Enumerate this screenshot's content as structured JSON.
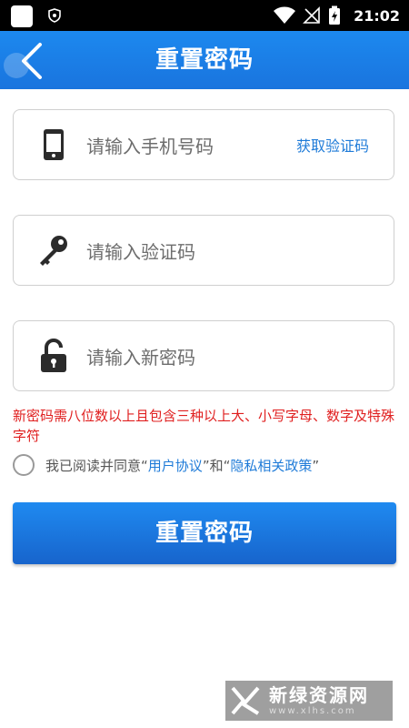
{
  "status_bar": {
    "time": "21:02"
  },
  "header": {
    "title": "重置密码",
    "back_icon": "chevron-left-icon"
  },
  "form": {
    "phone": {
      "placeholder": "请输入手机号码",
      "value": "",
      "get_code_label": "获取验证码",
      "icon": "phone-icon"
    },
    "code": {
      "placeholder": "请输入验证码",
      "value": "",
      "icon": "key-icon"
    },
    "password": {
      "placeholder": "请输入新密码",
      "value": "",
      "icon": "unlock-icon"
    }
  },
  "hint": "新密码需八位数以上且包含三种以上大、小写字母、数字及特殊字符",
  "agreement": {
    "prefix": "我已阅读并同意",
    "quote_open": "“",
    "quote_close": "”",
    "link_user": "用户协议",
    "conjunction": "和",
    "link_privacy": "隐私相关政策",
    "checked": false
  },
  "submit_label": "重置密码",
  "watermark": {
    "main": "新绿资源网",
    "sub": "www.xlhs.com"
  },
  "colors": {
    "accent": "#1a7ae2",
    "hint": "#e02020",
    "link": "#1f7bd8"
  }
}
